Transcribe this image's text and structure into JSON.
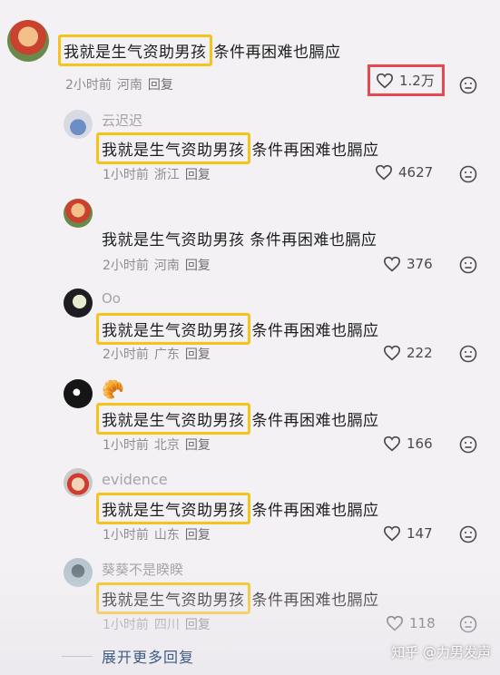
{
  "comments": [
    {
      "username": "",
      "prefix": "我就是生气资助男孩",
      "suffix": "条件再困难也膈应",
      "time": "2小时前",
      "location": "河南",
      "reply": "回复",
      "likes": "1.2万"
    },
    {
      "username": "云迟迟",
      "prefix": "我就是生气资助男孩",
      "suffix": "条件再困难也膈应",
      "time": "1小时前",
      "location": "浙江",
      "reply": "回复",
      "likes": "4627"
    },
    {
      "username": "",
      "prefix": "我就是生气资助男孩",
      "suffix": "条件再困难也膈应",
      "time": "2小时前",
      "location": "河南",
      "reply": "回复",
      "likes": "376"
    },
    {
      "username": "Oo",
      "prefix": "我就是生气资助男孩",
      "suffix": "条件再困难也膈应",
      "time": "2小时前",
      "location": "广东",
      "reply": "回复",
      "likes": "222"
    },
    {
      "username": "🥐",
      "prefix": "我就是生气资助男孩",
      "suffix": "条件再困难也膈应",
      "time": "1小时前",
      "location": "北京",
      "reply": "回复",
      "likes": "166"
    },
    {
      "username": "evidence",
      "prefix": "我就是生气资助男孩",
      "suffix": "条件再困难也膈应",
      "time": "1小时前",
      "location": "山东",
      "reply": "回复",
      "likes": "147"
    },
    {
      "username": "葵葵不是睽睽",
      "prefix": "我就是生气资助男孩",
      "suffix": "条件再困难也膈应",
      "time": "1小时前",
      "location": "四川",
      "reply": "回复",
      "likes": "118"
    }
  ],
  "more_replies": "展开更多回复",
  "watermark": "知乎 @力男发声",
  "colors": {
    "highlight_box": "#f6c31a",
    "like_box": "#e8494e",
    "link": "#3f5c85"
  }
}
